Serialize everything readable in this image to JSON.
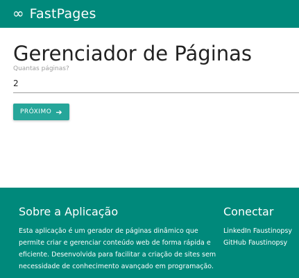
{
  "navbar": {
    "brand_icon": "∞",
    "brand_icon_name": "infinity-icon",
    "brand_name": "FastPages",
    "color": "#00897b"
  },
  "main": {
    "title": "Gerenciador de Páginas",
    "pages_field": {
      "label": "Quantas páginas?",
      "value": "2"
    },
    "next_button": {
      "label": "PRÓXIMO",
      "icon": "➔",
      "icon_name": "arrow-right-icon",
      "color": "#26a69a"
    }
  },
  "footer": {
    "color": "#00897b",
    "about": {
      "heading": "Sobre a Aplicação",
      "text": "Esta aplicação é um gerador de páginas dinâmico que permite criar e gerenciar conteúdo web de forma rápida e eficiente. Desenvolvida para facilitar a criação de sites sem necessidade de conhecimento avançado em programação."
    },
    "connect": {
      "heading": "Conectar",
      "links": [
        {
          "label": "LinkedIn Faustinopsy"
        },
        {
          "label": "GitHub Faustinopsy"
        }
      ]
    }
  }
}
